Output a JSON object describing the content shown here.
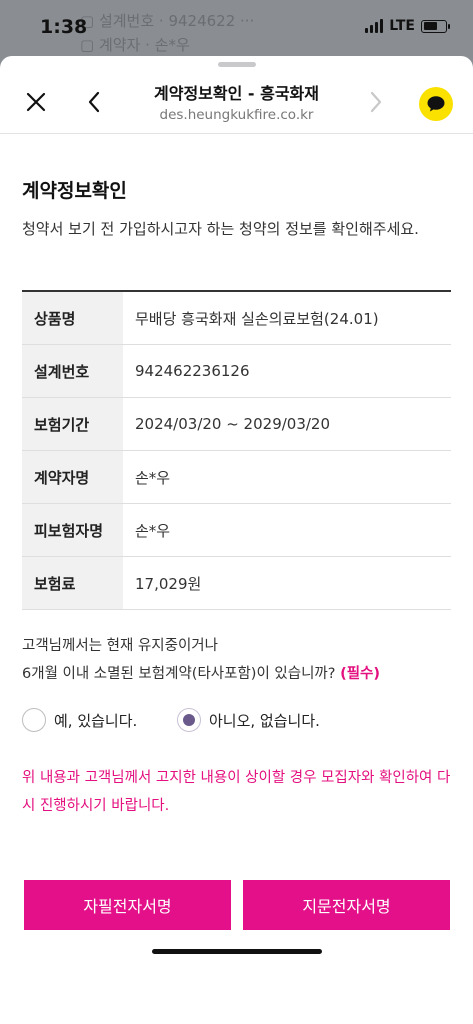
{
  "status_bar": {
    "time": "1:38",
    "network": "LTE"
  },
  "browser": {
    "title": "계약정보확인 - 흥국화재",
    "domain": "des.heungkukfire.co.kr"
  },
  "page": {
    "title": "계약정보확인",
    "description": "청약서 보기 전 가입하시고자 하는 청약의 정보를 확인해주세요."
  },
  "contract_info": [
    {
      "label": "상품명",
      "value": "무배당 흥국화재 실손의료보험(24.01)"
    },
    {
      "label": "설계번호",
      "value": "942462236126"
    },
    {
      "label": "보험기간",
      "value": "2024/03/20 ~ 2029/03/20"
    },
    {
      "label": "계약자명",
      "value": "손*우"
    },
    {
      "label": "피보험자명",
      "value": "손*우"
    },
    {
      "label": "보험료",
      "value": "17,029원"
    }
  ],
  "question": {
    "line1": "고객님께서는 현재 유지중이거나",
    "line2": "6개월 이내 소멸된 보험계약(타사포함)이 있습니까?",
    "required": "(필수)"
  },
  "options": {
    "yes": "예, 있습니다.",
    "no": "아니오, 없습니다.",
    "selected": "no"
  },
  "warning": "위 내용과 고객님께서 고지한 내용이 상이할 경우 모집자와 확인하여 다시 진행하시기 바랍니다.",
  "buttons": {
    "handwritten_sign": "자필전자서명",
    "fingerprint_sign": "지문전자서명"
  },
  "colors": {
    "accent": "#e4108a",
    "kakao": "#fae100"
  }
}
